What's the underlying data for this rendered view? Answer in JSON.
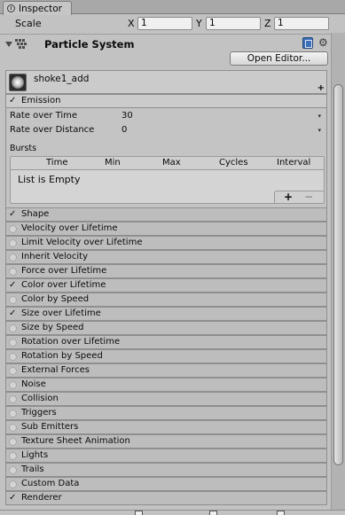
{
  "tab": {
    "title": "Inspector"
  },
  "transform": {
    "scale_label": "Scale",
    "x_label": "X",
    "x_value": "1",
    "y_label": "Y",
    "y_value": "1",
    "z_label": "Z",
    "z_value": "1"
  },
  "component": {
    "title": "Particle System",
    "open_editor_label": "Open Editor..."
  },
  "system": {
    "name": "shoke1_add",
    "add_label": "+"
  },
  "emission": {
    "label": "Emission",
    "rate_over_time_label": "Rate over Time",
    "rate_over_time_value": "30",
    "rate_over_distance_label": "Rate over Distance",
    "rate_over_distance_value": "0",
    "bursts_label": "Bursts",
    "bursts_columns": [
      "Time",
      "Min",
      "Max",
      "Cycles",
      "Interval"
    ],
    "bursts_empty": "List is Empty",
    "bursts_add": "+",
    "bursts_remove": "−"
  },
  "modules": [
    {
      "label": "Shape",
      "enabled": true
    },
    {
      "label": "Velocity over Lifetime",
      "enabled": false
    },
    {
      "label": "Limit Velocity over Lifetime",
      "enabled": false
    },
    {
      "label": "Inherit Velocity",
      "enabled": false
    },
    {
      "label": "Force over Lifetime",
      "enabled": false
    },
    {
      "label": "Color over Lifetime",
      "enabled": true
    },
    {
      "label": "Color by Speed",
      "enabled": false
    },
    {
      "label": "Size over Lifetime",
      "enabled": true
    },
    {
      "label": "Size by Speed",
      "enabled": false
    },
    {
      "label": "Rotation over Lifetime",
      "enabled": false
    },
    {
      "label": "Rotation by Speed",
      "enabled": false
    },
    {
      "label": "External Forces",
      "enabled": false
    },
    {
      "label": "Noise",
      "enabled": false
    },
    {
      "label": "Collision",
      "enabled": false
    },
    {
      "label": "Triggers",
      "enabled": false
    },
    {
      "label": "Sub Emitters",
      "enabled": false
    },
    {
      "label": "Texture Sheet Animation",
      "enabled": false
    },
    {
      "label": "Lights",
      "enabled": false
    },
    {
      "label": "Trails",
      "enabled": false
    },
    {
      "label": "Custom Data",
      "enabled": false
    },
    {
      "label": "Renderer",
      "enabled": true
    }
  ],
  "icons": {
    "check": "✓",
    "gear": "⚙",
    "dropdown": "▾"
  },
  "colors": {
    "background": "#c2c2c2",
    "header_bar": "#a8a8a8",
    "help_icon": "#3d6fb6"
  }
}
